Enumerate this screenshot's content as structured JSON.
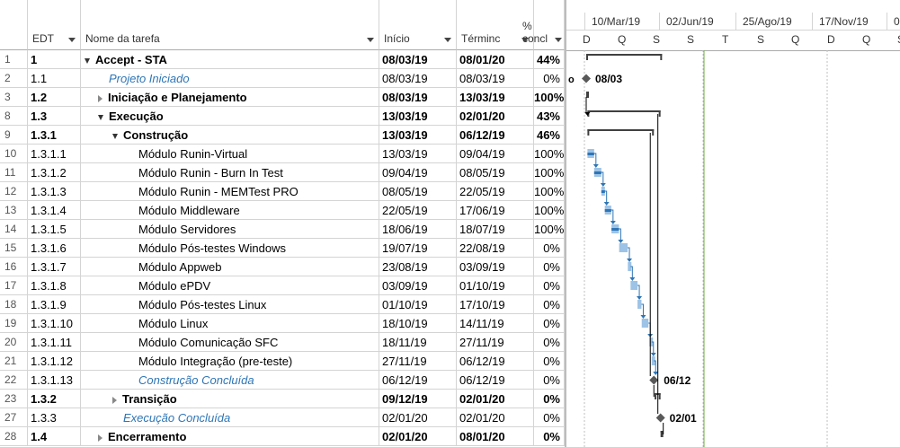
{
  "headers": {
    "edt": "EDT",
    "name": "Nome da tarefa",
    "start": "Início",
    "finish": "Términc",
    "pct_top": "%",
    "pct_bottom": "concl"
  },
  "timeline": {
    "major": [
      "10/Mar/19",
      "02/Jun/19",
      "25/Ago/19",
      "17/Nov/19",
      "0"
    ],
    "minor": [
      "D",
      "Q",
      "S",
      "S",
      "T",
      "S",
      "Q",
      "D",
      "Q",
      "S"
    ]
  },
  "rows": [
    {
      "id": "1",
      "edt": "1",
      "name": "Accept - STA",
      "start": "08/03/19",
      "finish": "08/01/20",
      "pct": "44%",
      "level": 0,
      "bold": true,
      "toggle": "open",
      "milestone": false
    },
    {
      "id": "2",
      "edt": "1.1",
      "name": "Projeto Iniciado",
      "start": "08/03/19",
      "finish": "08/03/19",
      "pct": "0%",
      "level": 1,
      "bold": false,
      "toggle": "",
      "milestone": true
    },
    {
      "id": "3",
      "edt": "1.2",
      "name": "Iniciação e Planejamento",
      "start": "08/03/19",
      "finish": "13/03/19",
      "pct": "100%",
      "level": 1,
      "bold": true,
      "toggle": "closed",
      "milestone": false
    },
    {
      "id": "8",
      "edt": "1.3",
      "name": "Execução",
      "start": "13/03/19",
      "finish": "02/01/20",
      "pct": "43%",
      "level": 1,
      "bold": true,
      "toggle": "open",
      "milestone": false
    },
    {
      "id": "9",
      "edt": "1.3.1",
      "name": "Construção",
      "start": "13/03/19",
      "finish": "06/12/19",
      "pct": "46%",
      "level": 2,
      "bold": true,
      "toggle": "open",
      "milestone": false
    },
    {
      "id": "10",
      "edt": "1.3.1.1",
      "name": "Módulo Runin-Virtual",
      "start": "13/03/19",
      "finish": "09/04/19",
      "pct": "100%",
      "level": 3,
      "bold": false,
      "toggle": "",
      "milestone": false
    },
    {
      "id": "11",
      "edt": "1.3.1.2",
      "name": "Módulo Runin - Burn In Test",
      "start": "09/04/19",
      "finish": "08/05/19",
      "pct": "100%",
      "level": 3,
      "bold": false,
      "toggle": "",
      "milestone": false
    },
    {
      "id": "12",
      "edt": "1.3.1.3",
      "name": "Módulo Runin - MEMTest PRO",
      "start": "08/05/19",
      "finish": "22/05/19",
      "pct": "100%",
      "level": 3,
      "bold": false,
      "toggle": "",
      "milestone": false
    },
    {
      "id": "13",
      "edt": "1.3.1.4",
      "name": "Módulo Middleware",
      "start": "22/05/19",
      "finish": "17/06/19",
      "pct": "100%",
      "level": 3,
      "bold": false,
      "toggle": "",
      "milestone": false
    },
    {
      "id": "14",
      "edt": "1.3.1.5",
      "name": "Módulo Servidores",
      "start": "18/06/19",
      "finish": "18/07/19",
      "pct": "100%",
      "level": 3,
      "bold": false,
      "toggle": "",
      "milestone": false
    },
    {
      "id": "15",
      "edt": "1.3.1.6",
      "name": "Módulo Pós-testes Windows",
      "start": "19/07/19",
      "finish": "22/08/19",
      "pct": "0%",
      "level": 3,
      "bold": false,
      "toggle": "",
      "milestone": false
    },
    {
      "id": "16",
      "edt": "1.3.1.7",
      "name": "Módulo Appweb",
      "start": "23/08/19",
      "finish": "03/09/19",
      "pct": "0%",
      "level": 3,
      "bold": false,
      "toggle": "",
      "milestone": false
    },
    {
      "id": "17",
      "edt": "1.3.1.8",
      "name": "Módulo ePDV",
      "start": "03/09/19",
      "finish": "01/10/19",
      "pct": "0%",
      "level": 3,
      "bold": false,
      "toggle": "",
      "milestone": false
    },
    {
      "id": "18",
      "edt": "1.3.1.9",
      "name": "Módulo Pós-testes Linux",
      "start": "01/10/19",
      "finish": "17/10/19",
      "pct": "0%",
      "level": 3,
      "bold": false,
      "toggle": "",
      "milestone": false
    },
    {
      "id": "19",
      "edt": "1.3.1.10",
      "name": "Módulo Linux",
      "start": "18/10/19",
      "finish": "14/11/19",
      "pct": "0%",
      "level": 3,
      "bold": false,
      "toggle": "",
      "milestone": false
    },
    {
      "id": "20",
      "edt": "1.3.1.11",
      "name": "Módulo Comunicação SFC",
      "start": "18/11/19",
      "finish": "27/11/19",
      "pct": "0%",
      "level": 3,
      "bold": false,
      "toggle": "",
      "milestone": false
    },
    {
      "id": "21",
      "edt": "1.3.1.12",
      "name": "Módulo Integração (pre-teste)",
      "start": "27/11/19",
      "finish": "06/12/19",
      "pct": "0%",
      "level": 3,
      "bold": false,
      "toggle": "",
      "milestone": false
    },
    {
      "id": "22",
      "edt": "1.3.1.13",
      "name": "Construção Concluída",
      "start": "06/12/19",
      "finish": "06/12/19",
      "pct": "0%",
      "level": 3,
      "bold": false,
      "toggle": "",
      "milestone": true
    },
    {
      "id": "23",
      "edt": "1.3.2",
      "name": "Transição",
      "start": "09/12/19",
      "finish": "02/01/20",
      "pct": "0%",
      "level": 2,
      "bold": true,
      "toggle": "closed",
      "milestone": false
    },
    {
      "id": "27",
      "edt": "1.3.3",
      "name": "Execução Concluída",
      "start": "02/01/20",
      "finish": "02/01/20",
      "pct": "0%",
      "level": 2,
      "bold": false,
      "toggle": "",
      "milestone": true
    },
    {
      "id": "28",
      "edt": "1.4",
      "name": "Encerramento",
      "start": "02/01/20",
      "finish": "08/01/20",
      "pct": "0%",
      "level": 1,
      "bold": true,
      "toggle": "closed",
      "milestone": false
    }
  ],
  "milestone_labels": {
    "projeto_iniciado": "08/03",
    "construcao_concluida": "06/12",
    "execucao_concluida": "02/01"
  },
  "stray_label": "o",
  "colors": {
    "task_bar": "#9dc3e6",
    "progress_bar": "#2e75b6",
    "summary": "#404040",
    "milestone": "#595959",
    "today_line": "#70ad47",
    "milestone_text": "#2e75b6"
  }
}
